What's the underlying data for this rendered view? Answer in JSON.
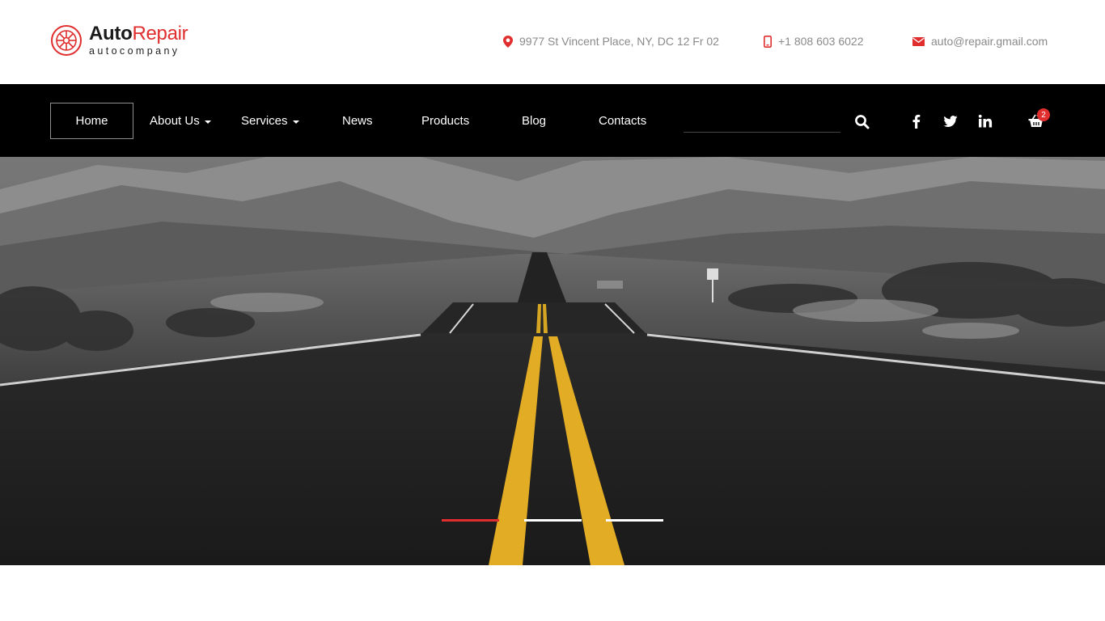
{
  "brand": {
    "name_part1": "Auto",
    "name_part2": "Repair",
    "tagline": "autocompany",
    "accent_color": "#e02d2d"
  },
  "contacts": {
    "address": "9977 St Vincent Place, NY, DC 12 Fr 02",
    "phone": "+1 808 603 6022",
    "email": "auto@repair.gmail.com"
  },
  "nav": {
    "items": [
      {
        "label": "Home",
        "active": true
      },
      {
        "label": "About Us",
        "has_dropdown": true
      },
      {
        "label": "Services",
        "has_dropdown": true
      },
      {
        "label": "News"
      },
      {
        "label": "Products"
      },
      {
        "label": "Blog"
      },
      {
        "label": "Contacts"
      }
    ],
    "search_placeholder": ""
  },
  "social": [
    "facebook-icon",
    "twitter-icon",
    "linkedin-icon"
  ],
  "cart": {
    "count": "2"
  },
  "hero": {
    "image": "desert-road-photo",
    "slides": 3,
    "active_slide": 1
  }
}
